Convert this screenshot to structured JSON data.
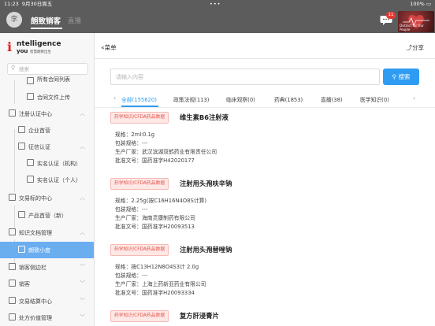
{
  "status_bar": {
    "time": "11:23",
    "date": "9月30日周五",
    "dots": "•••",
    "battery": "100%"
  },
  "top_bar": {
    "avatar_text": "李",
    "tabs": [
      "朗致销客",
      "直播"
    ],
    "notification_count": "11",
    "brand_tag": "Distinct for Our People"
  },
  "sidebar": {
    "logo": {
      "letter": "i",
      "word1": "ntelligence",
      "word2": "you",
      "subtitle": "智慧朗致出生"
    },
    "search_placeholder": "搜索",
    "items": [
      {
        "label": "所有合同列表",
        "level": 2
      },
      {
        "label": "合同文件上传",
        "level": 2
      },
      {
        "label": "注册认证中心",
        "level": 1
      },
      {
        "label": "企业首营",
        "level": 2
      },
      {
        "label": "征信认证",
        "level": 2
      },
      {
        "label": "实名认证（机构）",
        "level": 3
      },
      {
        "label": "实名认证（个人）",
        "level": 3
      },
      {
        "label": "交易标的中心",
        "level": 1
      },
      {
        "label": "产品首营（新）",
        "level": 2
      },
      {
        "label": "知识文档管理",
        "level": 1
      },
      {
        "label": "朗致小度",
        "level": 2
      },
      {
        "label": "销客侧边栏",
        "level": 1
      },
      {
        "label": "销客",
        "level": 1
      },
      {
        "label": "交易结算中心",
        "level": 1
      },
      {
        "label": "处方价值管理",
        "level": 1
      }
    ]
  },
  "main": {
    "menu_label": "菜单",
    "share_label": "分享",
    "search": {
      "placeholder": "请输入内容",
      "button_label": "搜索"
    },
    "tabs": [
      {
        "label": "全部(155620)",
        "active": true
      },
      {
        "label": "政策法规(113)"
      },
      {
        "label": "临床观察(0)"
      },
      {
        "label": "药典(1853)"
      },
      {
        "label": "直播(38)"
      },
      {
        "label": "医学知识(0)"
      }
    ],
    "results": [
      {
        "category": "药学知识/CFDA药品数据",
        "title": "维生素B6注射液",
        "lines": [
          "规格：2ml∶0.1g",
          "包装规格：---",
          "生产厂家：武汉滨湖双鹤药业有限责任公司",
          "批准文号：国药准字H42020177"
        ]
      },
      {
        "category": "药学知识/CFDA药品数据",
        "title": "注射用头孢呋辛钠",
        "lines": [
          "规格：2.25g(按C16H16N4O8S计算)",
          "包装规格：---",
          "生产厂家：海南灵康制药有限公司",
          "批准文号：国药准字H20093513"
        ]
      },
      {
        "category": "药学知识/CFDA药品数据",
        "title": "注射用头孢替唑钠",
        "lines": [
          "规格：按C13H12N8O4S3计 2.0g",
          "包装规格：---",
          "生产厂家：上海上药新亚药业有限公司",
          "批准文号：国药准字H20093334"
        ]
      },
      {
        "category": "药学知识/CFDA药品数据",
        "title": "复方肝浸膏片",
        "lines": []
      }
    ]
  },
  "colors": {
    "accent": "#2e9cf2",
    "sidebar_active": "#6aaef0",
    "category_tag": "#e5544b",
    "top_bar": "#5c5c5c"
  }
}
